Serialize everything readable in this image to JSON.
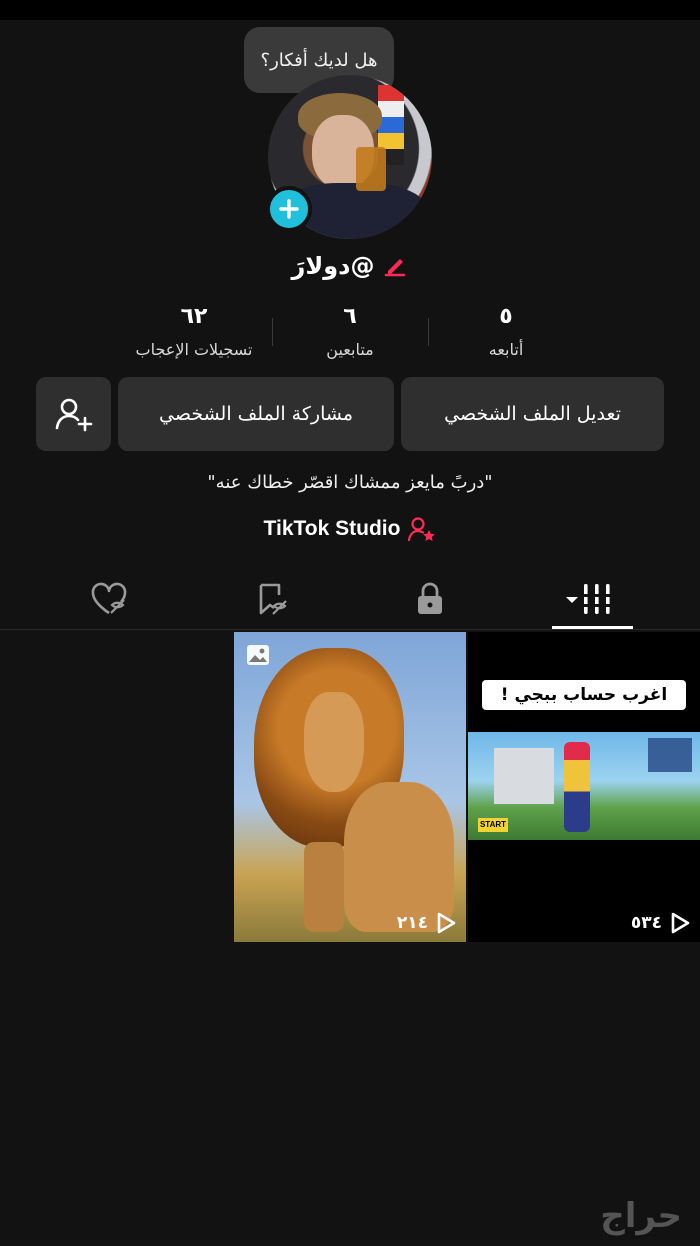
{
  "profile": {
    "tooltip": "هل لديك أفكار؟",
    "username": "@دولارَ",
    "bio": "\"دربً مايعز ممشاك اقصّر خطاك عنه\"",
    "studio_label": "TikTok Studio"
  },
  "stats": {
    "likes": {
      "value": "٦٢",
      "label": "تسجيلات الإعجاب"
    },
    "followers": {
      "value": "٦",
      "label": "متابعين"
    },
    "following": {
      "value": "٥",
      "label": "أتابعه"
    }
  },
  "buttons": {
    "share": "مشاركة الملف الشخصي",
    "edit": "تعديل الملف الشخصي"
  },
  "tabs": [
    {
      "icon": "liked-hidden-icon"
    },
    {
      "icon": "saved-hidden-icon"
    },
    {
      "icon": "lock-icon"
    },
    {
      "icon": "grid-dropdown-icon",
      "active": true
    }
  ],
  "videos": [
    {
      "type": "photo",
      "views": "٢١٤"
    },
    {
      "type": "video",
      "views": "٥٣٤",
      "caption": "اغرب حساب ببجي !",
      "overlay": "START"
    }
  ],
  "watermark": "حراج",
  "colors": {
    "background": "#121212",
    "button": "#2f2f2f",
    "accent_cyan": "#20c0dc",
    "accent_pink": "#fe2c55"
  }
}
